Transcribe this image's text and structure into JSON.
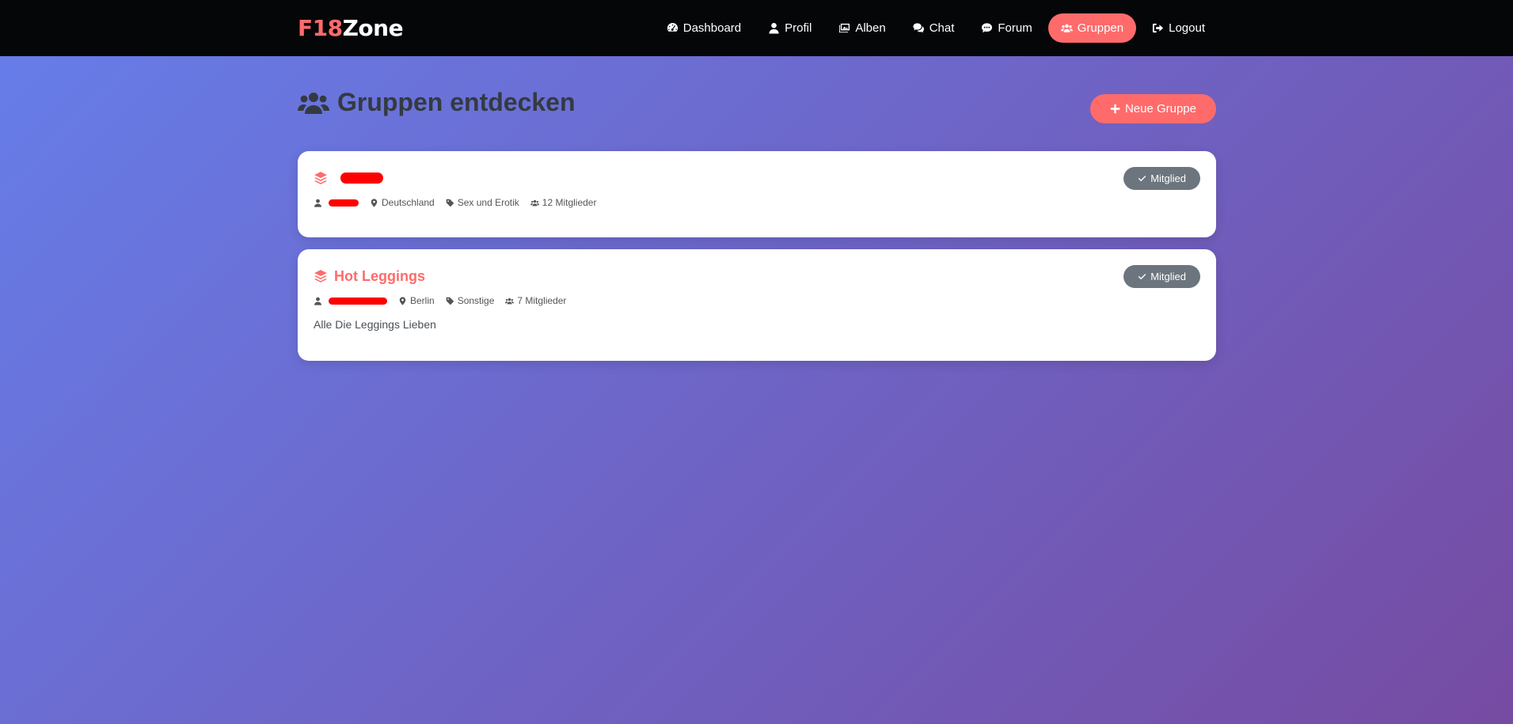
{
  "brand": {
    "accent": "F18",
    "rest": "Zone"
  },
  "nav": {
    "dashboard": "Dashboard",
    "profil": "Profil",
    "alben": "Alben",
    "chat": "Chat",
    "forum": "Forum",
    "gruppen": "Gruppen",
    "logout": "Logout"
  },
  "page": {
    "title": "Gruppen entdecken",
    "new_group_label": "Neue Gruppe"
  },
  "groups": [
    {
      "name": "",
      "owner": "",
      "location": "Deutschland",
      "category": "Sex und Erotik",
      "members": "12 Mitglieder",
      "description": "",
      "status": "Mitglied"
    },
    {
      "name": "Hot Leggings",
      "owner": "",
      "location": "Berlin",
      "category": "Sonstige",
      "members": "7 Mitglieder",
      "description": "Alle Die Leggings Lieben",
      "status": "Mitglied"
    }
  ],
  "colors": {
    "accent": "#ff6b6b",
    "navbar": "#050608",
    "badge": "#6c757d",
    "redaction": "#ff0000"
  },
  "icons": {
    "dashboard": "gauge-icon",
    "profil": "user-icon",
    "alben": "images-icon",
    "chat": "comments-icon",
    "forum": "comment-icon",
    "gruppen": "users-icon",
    "logout": "sign-out-icon",
    "group": "layer-group-icon",
    "location": "map-marker-icon",
    "category": "tag-icon"
  }
}
